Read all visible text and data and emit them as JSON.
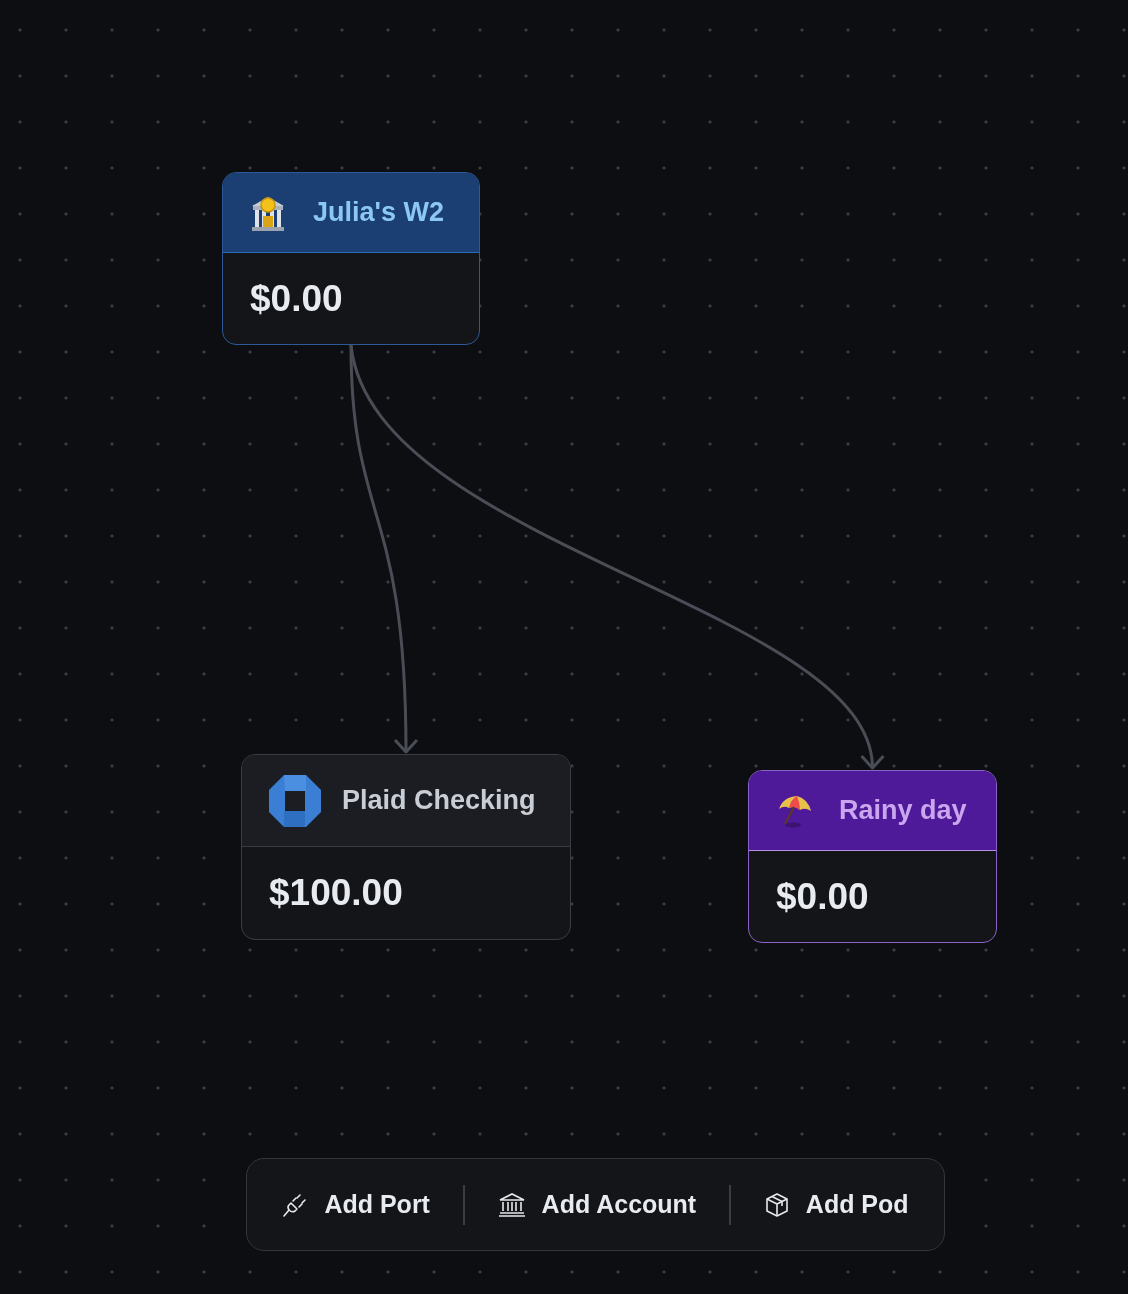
{
  "nodes": [
    {
      "kind": "income",
      "title": "Julia's W2",
      "amount": "$0.00"
    },
    {
      "kind": "account",
      "title": "Plaid Checking",
      "amount": "$100.00"
    },
    {
      "kind": "pod",
      "title": "Rainy day",
      "amount": "$0.00"
    }
  ],
  "toolbar": [
    {
      "kind": "port",
      "label": "Add Port"
    },
    {
      "kind": "account",
      "label": "Add Account"
    },
    {
      "kind": "pod",
      "label": "Add Pod"
    }
  ]
}
